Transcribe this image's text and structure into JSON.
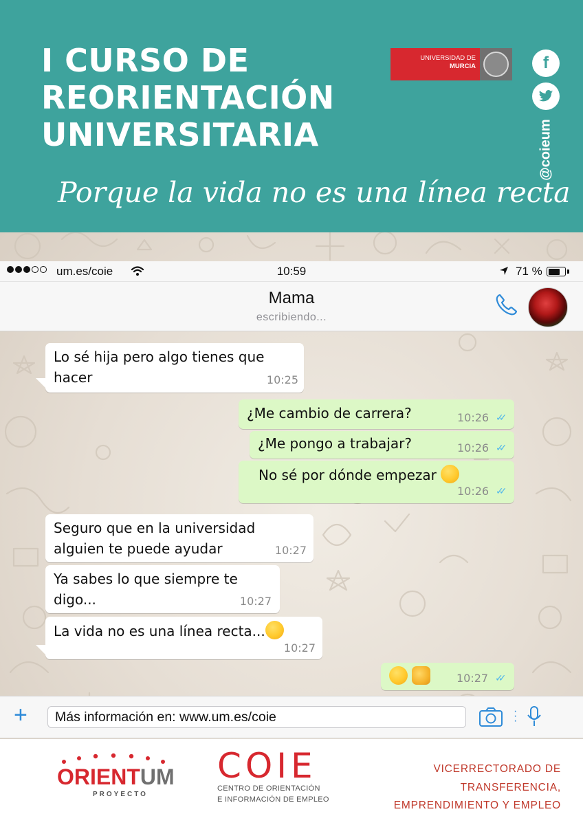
{
  "poster": {
    "title_lines": [
      "I CURSO DE",
      "REORIENTACIÓN",
      "UNIVERSITARIA"
    ],
    "tagline": "Porque la vida no es una línea recta",
    "university": {
      "line1": "UNIVERSIDAD DE",
      "line2": "MURCIA"
    },
    "social": {
      "facebook_icon": "facebook-icon",
      "twitter_icon": "twitter-icon",
      "handle": "@coieum"
    }
  },
  "status_bar": {
    "carrier": "um.es/coie",
    "time": "10:59",
    "battery": "71 %",
    "battery_level": 0.71
  },
  "chat_header": {
    "contact_name": "Mama",
    "status": "escribiendo...",
    "call_icon": "phone-icon",
    "avatar_icon": "rose-avatar"
  },
  "messages": [
    {
      "dir": "in",
      "text": "Lo sé hija pero algo tienes que hacer",
      "lines": [
        "Lo sé hija pero algo tienes que",
        "hacer"
      ],
      "time": "10:25"
    },
    {
      "dir": "out",
      "text": "¿Me cambio de carrera?",
      "time": "10:26",
      "read": true
    },
    {
      "dir": "out",
      "text": "¿Me pongo a trabajar?",
      "time": "10:26",
      "read": true
    },
    {
      "dir": "out",
      "text": "No sé por dónde empezar",
      "emoji": "weary-face-emoji",
      "time": "10:26",
      "read": true
    },
    {
      "dir": "in",
      "text": "Seguro que en la universidad alguien te puede ayudar",
      "lines": [
        "Seguro que en la universidad",
        "alguien te puede ayudar"
      ],
      "time": "10:27"
    },
    {
      "dir": "in",
      "text": "Ya sabes lo que siempre te digo...",
      "lines": [
        "Ya sabes lo que siempre te",
        "digo..."
      ],
      "time": "10:27"
    },
    {
      "dir": "in",
      "text": "La vida no es una línea recta...",
      "emoji": "winking-tongue-emoji",
      "time": "10:27"
    },
    {
      "dir": "out",
      "text": "",
      "emojis": [
        "sunglasses-emoji",
        "thumbs-up-emoji"
      ],
      "time": "10:27",
      "read": true
    }
  ],
  "input_bar": {
    "value": "Más información en: www.um.es/coie",
    "plus_icon": "plus-icon",
    "camera_icon": "camera-icon",
    "mic_icon": "microphone-icon"
  },
  "footer": {
    "orientum": {
      "word_main": "ORIENT",
      "word_end": "UM",
      "sub": "PROYECTO"
    },
    "coie": {
      "word": "COIE",
      "sub_line1": "CENTRO DE ORIENTACIÓN",
      "sub_line2": "E INFORMACIÓN DE EMPLEO"
    },
    "vicerrectorado": {
      "line1": "VICERRECTORADO DE TRANSFERENCIA,",
      "line2": "EMPRENDIMIENTO Y EMPLEO"
    }
  },
  "colors": {
    "header_teal": "#3ea39d",
    "um_red": "#d7282f",
    "bubble_out": "#dcf8c6",
    "bubble_in": "#ffffff",
    "read_ticks": "#4fb6ec",
    "ios_blue": "#2f8bd8"
  }
}
